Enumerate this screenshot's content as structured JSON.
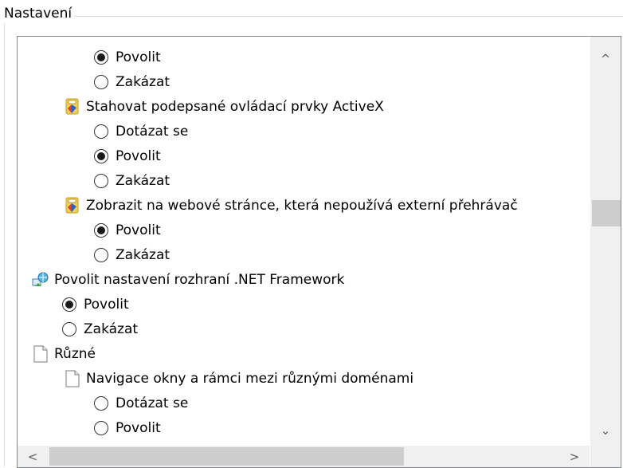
{
  "group": {
    "title": "Nastavení"
  },
  "tree": {
    "rows": [
      {
        "type": "radio",
        "label": "Povolit",
        "checked": true
      },
      {
        "type": "radio",
        "label": "Zakázat",
        "checked": false
      },
      {
        "type": "item",
        "icon": "activex-settings-icon",
        "label": "Stahovat podepsané ovládací prvky ActiveX"
      },
      {
        "type": "radio",
        "label": "Dotázat se",
        "checked": false
      },
      {
        "type": "radio",
        "label": "Povolit",
        "checked": true
      },
      {
        "type": "radio",
        "label": "Zakázat",
        "checked": false
      },
      {
        "type": "item",
        "icon": "activex-settings-icon",
        "label": "Zobrazit na webové stránce, která nepoužívá externí přehrávač"
      },
      {
        "type": "radio",
        "label": "Povolit",
        "checked": true
      },
      {
        "type": "radio",
        "label": "Zakázat",
        "checked": false
      },
      {
        "type": "item",
        "icon": "net-framework-icon",
        "label": "Povolit nastavení rozhraní .NET Framework"
      },
      {
        "type": "radio",
        "label": "Povolit",
        "checked": true
      },
      {
        "type": "radio",
        "label": "Zakázat",
        "checked": false
      },
      {
        "type": "item",
        "icon": "document-icon",
        "label": "Různé"
      },
      {
        "type": "item",
        "icon": "document-icon",
        "label": "Navigace okny a rámci mezi různými doménami"
      },
      {
        "type": "radio",
        "label": "Dotázat se",
        "checked": false
      },
      {
        "type": "radio",
        "label": "Povolit",
        "checked": false
      }
    ]
  },
  "scrollbars": {
    "up_arrow": "^",
    "down_arrow": "⌄",
    "left_arrow": "<",
    "right_arrow": ">"
  }
}
